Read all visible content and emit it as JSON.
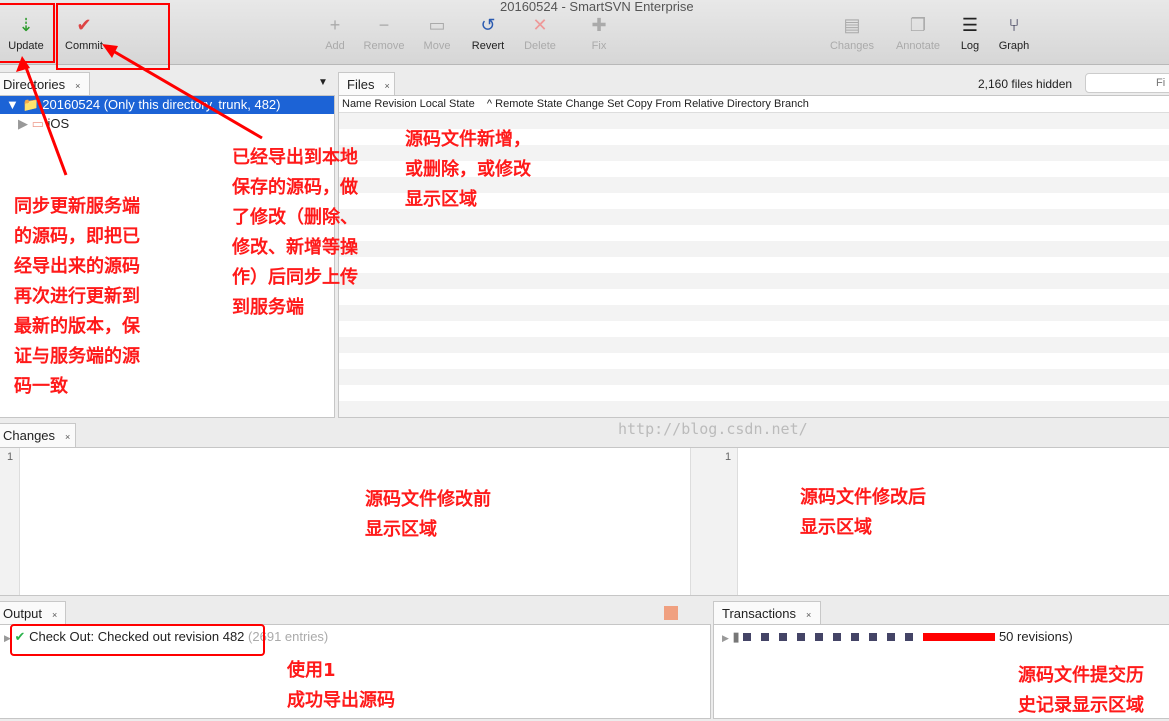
{
  "window": {
    "title": "20160524 - SmartSVN Enterprise"
  },
  "toolbar": [
    {
      "label": "Update",
      "icon": "update-icon",
      "enabled": true
    },
    {
      "label": "Commit",
      "icon": "commit-icon",
      "enabled": true
    },
    {
      "label": "Add",
      "icon": "add-icon",
      "enabled": false
    },
    {
      "label": "Remove",
      "icon": "remove-icon",
      "enabled": false
    },
    {
      "label": "Move",
      "icon": "move-icon",
      "enabled": false
    },
    {
      "label": "Revert",
      "icon": "revert-icon",
      "enabled": true
    },
    {
      "label": "Delete",
      "icon": "delete-icon",
      "enabled": false
    },
    {
      "label": "Fix",
      "icon": "fix-icon",
      "enabled": false
    },
    {
      "label": "Changes",
      "icon": "changes-icon",
      "enabled": false
    },
    {
      "label": "Annotate",
      "icon": "annotate-icon",
      "enabled": false
    },
    {
      "label": "Log",
      "icon": "log-icon",
      "enabled": true
    },
    {
      "label": "Graph",
      "icon": "graph-icon",
      "enabled": true
    }
  ],
  "directories": {
    "tab": "Directories",
    "root": "20160524 (Only this directory, trunk, 482)",
    "child": "iOS"
  },
  "files": {
    "tab": "Files",
    "hidden": "2,160 files hidden",
    "filter_placeholder": "Fi",
    "columns": [
      "Name",
      "Revision",
      "Local State",
      "Remote State",
      "Change Set",
      "Copy From",
      "Relative Directory",
      "Branch"
    ]
  },
  "changes": {
    "tab": "Changes",
    "left_line": "1",
    "right_line": "1"
  },
  "output": {
    "tab": "Output",
    "message": "Check Out: Checked out revision 482",
    "extra": "(2691 entries)"
  },
  "transactions": {
    "tab": "Transactions",
    "summary": "50 revisions)"
  },
  "annotations": {
    "update": [
      "同步更新服务端",
      "的源码，即把已",
      "经导出来的源码",
      "再次进行更新到",
      "最新的版本，保",
      "证与服务端的源",
      "码一致"
    ],
    "commit": [
      "已经导出到本地",
      "保存的源码，做",
      "了修改（删除、",
      "修改、新增等操",
      "作）后同步上传",
      "到服务端"
    ],
    "files": [
      "源码文件新增，",
      "或删除，或修改",
      "显示区域"
    ],
    "before": [
      "源码文件修改前",
      "显示区域"
    ],
    "after": [
      "源码文件修改后",
      "显示区域"
    ],
    "output": [
      "使用1",
      "成功导出源码"
    ],
    "transactions": [
      "源码文件提交历",
      "史记录显示区域"
    ]
  },
  "watermark": "http://blog.csdn.net/"
}
